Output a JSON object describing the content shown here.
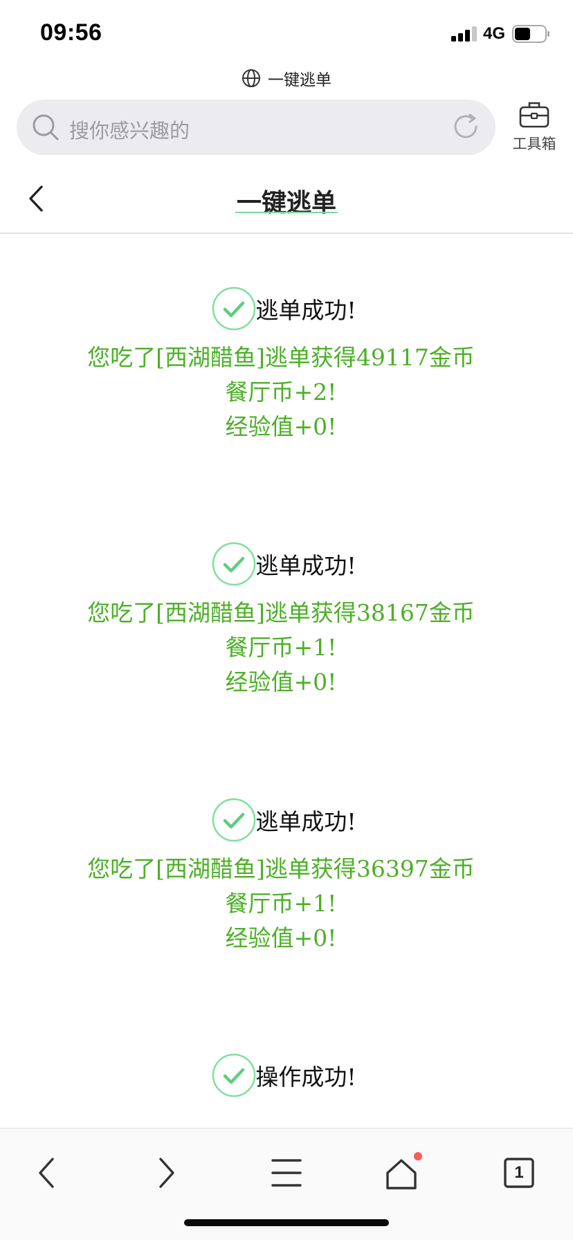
{
  "status_bar": {
    "time": "09:56",
    "network": "4G"
  },
  "site": {
    "title": "一键逃单"
  },
  "search": {
    "placeholder": "搜你感兴趣的"
  },
  "toolbox": {
    "label": "工具箱"
  },
  "header": {
    "title": "一键逃单"
  },
  "results": [
    {
      "title": "逃单成功!",
      "lines": [
        "您吃了[西湖醋鱼]逃单获得49117金币",
        "餐厅币+2!",
        "经验值+0!"
      ]
    },
    {
      "title": "逃单成功!",
      "lines": [
        "您吃了[西湖醋鱼]逃单获得38167金币",
        "餐厅币+1!",
        "经验值+0!"
      ]
    },
    {
      "title": "逃单成功!",
      "lines": [
        "您吃了[西湖醋鱼]逃单获得36397金币",
        "餐厅币+1!",
        "经验值+0!"
      ]
    },
    {
      "title": "操作成功!",
      "lines": []
    }
  ],
  "bottom_nav": {
    "tab_count": "1"
  },
  "colors": {
    "accent_green": "#4caf27",
    "check_green": "#5ccf7e",
    "notification_dot": "#ff5a5a"
  },
  "icons": [
    "signal-icon",
    "battery-icon",
    "globe-icon",
    "search-icon",
    "refresh-icon",
    "toolbox-icon",
    "back-icon",
    "check-icon",
    "nav-back-icon",
    "nav-forward-icon",
    "menu-icon",
    "home-icon",
    "tabs-icon"
  ]
}
